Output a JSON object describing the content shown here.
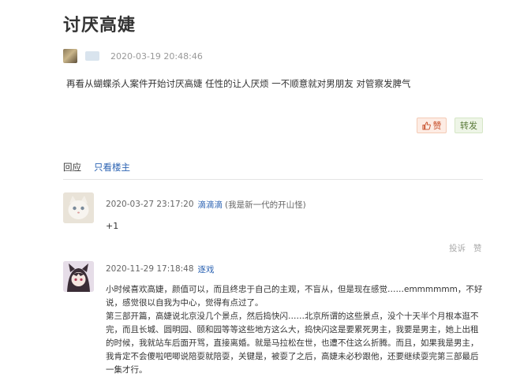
{
  "post": {
    "title": "讨厌高婕",
    "time": "2020-03-19 20:48:46",
    "body": "再看从蝴蝶杀人案件开始讨厌高婕 任性的让人厌烦 一不顺意就对男朋友 对管察发脾气",
    "like_label": "赞",
    "share_label": "转发"
  },
  "tabs": {
    "reply": "回应",
    "author_only": "只看楼主"
  },
  "comments": [
    {
      "time": "2020-03-27 23:17:20",
      "user": "滴滴滴",
      "note": "(我是新一代的开山怪)",
      "text": "+1",
      "report_label": "投诉",
      "like_label": "赞"
    },
    {
      "time": "2020-11-29 17:18:48",
      "user": "逐戏",
      "paragraphs": [
        "小时候喜欢高婕，颜值可以，而且终忠于自己的主观，不盲从，但是现在感觉……emmmmmm，不好说，感觉很以自我为中心，觉得有点过了。",
        "第三部开篇，高婕说北京没几个景点，然后捣快闪……北京所谓的这些景点，没个十天半个月根本逛不完，而且长城、圆明园、颐和园等等这些地方这么大，捣快闪这是要累死男主，我要是男主，她上出租的时候，我就站车后面开骂，直接离婚。就是马拉松在世，也遭不住这么折腾。而且，如果我是男主，我肯定不会傻啦吧唧说陪耍就陪耍，关键是，被耍了之后，高婕未必秒跟他，还要继续耍完第三部最后一集才行。"
      ]
    }
  ]
}
